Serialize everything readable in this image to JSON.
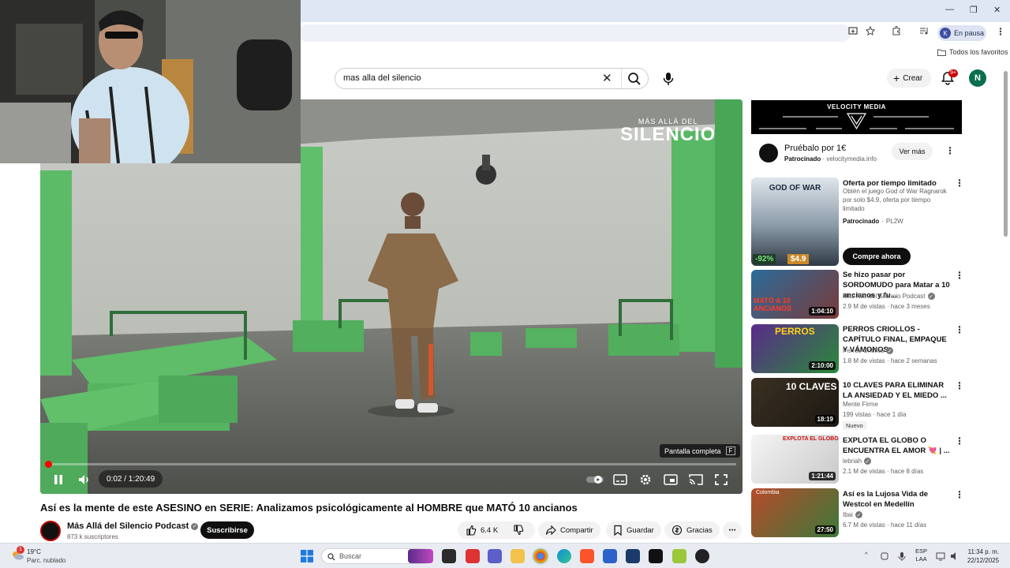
{
  "browser": {
    "profile_initial": "K",
    "profile_status": "En pausa",
    "bookmarks_folder": "Todos los favoritos",
    "window_controls": [
      "—",
      "❐",
      "✕"
    ]
  },
  "header": {
    "search_value": "mas alla del silencio",
    "create_label": "Crear",
    "notif_count": "9+",
    "avatar_initial": "N"
  },
  "player": {
    "overlay_brand_top": "MÁS ALLÁ DEL",
    "overlay_brand_main": "SILENCIO",
    "tooltip_label": "Pantalla completa",
    "tooltip_key": "F",
    "time_display": "0:02 / 1:20:49",
    "progress_fraction": 0.001
  },
  "video": {
    "title": "Así es la mente de este ASESINO en SERIE: Analizamos psicológicamente al HOMBRE que MATÓ 10 ancianos",
    "channel": "Más Allá del Silencio Podcast",
    "subscribers": "873 k suscriptores",
    "subscribe_label": "Suscribirse",
    "likes": "6.4 K",
    "share_label": "Compartir",
    "save_label": "Guardar",
    "thanks_label": "Gracias"
  },
  "sidebar": {
    "ad_banner": {
      "brand": "VELOCITY MEDIA",
      "title": "Pruébalo por 1€",
      "sponsored": "Patrocinado",
      "domain": "velocitymedia.info",
      "cta": "Ver más"
    },
    "ad_game": {
      "title": "Oferta por tiempo limitado",
      "desc": "Obtén el juego God of War Ragnarok por solo $4.9, oferta por tiempo limitado",
      "sponsored": "Patrocinado",
      "advertiser": "PL2W",
      "thumb_text": "GOD OF WAR",
      "discount": "-92%",
      "price": "$4.9",
      "cta": "Compre ahora"
    },
    "recs": [
      {
        "title": "Se hizo pasar por SORDOMUDO para Matar a 10 ancianos y fu...",
        "channel": "Más Allá del Silencio Podcast",
        "meta": "2.9 M de vistas · hace 3 meses",
        "duration": "1:04:10",
        "thumb_text": "MATÓ A 10 ANCIANOS",
        "badge": ""
      },
      {
        "title": "PERROS CRIOLLOS - CAPÍTULO FINAL, EMPAQUE Y VÁMONOS",
        "channel": "Perros Criollos",
        "meta": "1.8 M de vistas · hace 2 semanas",
        "duration": "2:10:00",
        "thumb_text": "PERROS",
        "badge": ""
      },
      {
        "title": "10 CLAVES PARA ELIMINAR LA ANSIEDAD Y EL MIEDO ...",
        "channel": "Mente Firme",
        "meta": "199 vistas · hace 1 día",
        "duration": "18:19",
        "thumb_text": "10 CLAVES",
        "badge": "Nuevo"
      },
      {
        "title": "EXPLOTA EL GLOBO O ENCUENTRA EL AMOR 💘 | ...",
        "channel": "lebriah",
        "meta": "2.1 M de vistas · hace 8 días",
        "duration": "1:21:44",
        "thumb_text": "EXPLOTA EL GLOBO",
        "badge": ""
      },
      {
        "title": "Así es la Lujosa Vida de Westcol en Medellín",
        "channel": "Ibai",
        "meta": "6.7 M de vistas · hace 11 días",
        "duration": "27:50",
        "thumb_text": "Colombia",
        "badge": ""
      }
    ]
  },
  "taskbar": {
    "temp": "19°C",
    "weather": "Parc. nublado",
    "weather_badge": "1",
    "search_placeholder": "Buscar",
    "lang_top": "ESP",
    "lang_bottom": "LAA",
    "time": "11:34 p. m.",
    "date": "22/12/2025"
  },
  "colors": {
    "youtube_red": "#ff0000",
    "accent_dark": "#0f0f0f"
  },
  "icons": [
    "search-icon",
    "clear-icon",
    "mic-icon",
    "plus-icon",
    "bell-icon",
    "pause-icon",
    "volume-icon",
    "autoplay-toggle",
    "subtitles-icon",
    "settings-icon",
    "miniplayer-icon",
    "cast-icon",
    "fullscreen-icon",
    "like-icon",
    "dislike-icon",
    "share-icon",
    "save-icon",
    "thanks-icon",
    "more-icon",
    "windows-start-icon"
  ]
}
